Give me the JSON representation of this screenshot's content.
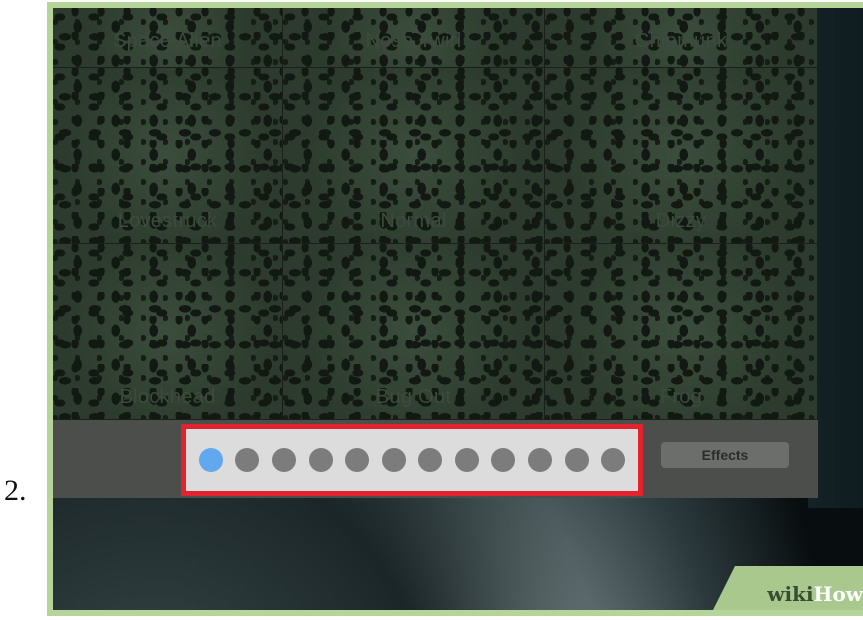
{
  "step_number": "2.",
  "effects_grid": [
    {
      "label": "Space Alien"
    },
    {
      "label": "Nose Twirl"
    },
    {
      "label": "Chipmunk"
    },
    {
      "label": "Lovestruck"
    },
    {
      "label": "Normal"
    },
    {
      "label": "Dizzy"
    },
    {
      "label": "Blockhead"
    },
    {
      "label": "Bug Out"
    },
    {
      "label": "Frog"
    }
  ],
  "pager": {
    "page_count": 12,
    "active_index": 0,
    "active_color": "#62a8ee",
    "inactive_color": "#7c7c7c",
    "highlight_color": "#e2222f"
  },
  "toolbar": {
    "effects_label": "Effects"
  },
  "watermark": {
    "prefix": "wiki",
    "suffix": "How"
  }
}
